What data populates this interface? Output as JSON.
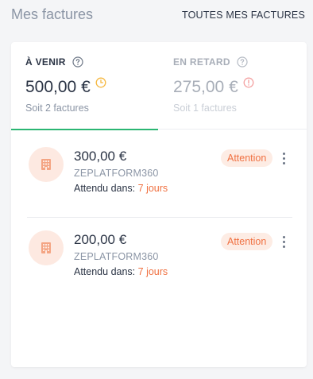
{
  "header": {
    "title": "Mes factures",
    "all_link": "TOUTES MES FACTURES"
  },
  "tabs": [
    {
      "label": "À VENIR",
      "amount": "500,00 €",
      "count": "Soit 2 factures",
      "status_icon": "clock-icon",
      "icon_color": "#f5b841",
      "active": true
    },
    {
      "label": "EN RETARD",
      "amount": "275,00 €",
      "count": "Soit 1 factures",
      "status_icon": "alert-circle-icon",
      "icon_color": "#f4a3a3",
      "active": false
    }
  ],
  "invoices": [
    {
      "amount": "300,00 €",
      "supplier": "ZEPLATFORM360",
      "due_label": "Attendu dans:",
      "due_value": "7 jours",
      "badge": "Attention",
      "icon": "building-icon"
    },
    {
      "amount": "200,00 €",
      "supplier": "ZEPLATFORM360",
      "due_label": "Attendu dans:",
      "due_value": "7 jours",
      "badge": "Attention",
      "icon": "building-icon"
    }
  ],
  "colors": {
    "accent": "#2bb673",
    "warning": "#f07142",
    "badge_bg": "#fdece4"
  }
}
